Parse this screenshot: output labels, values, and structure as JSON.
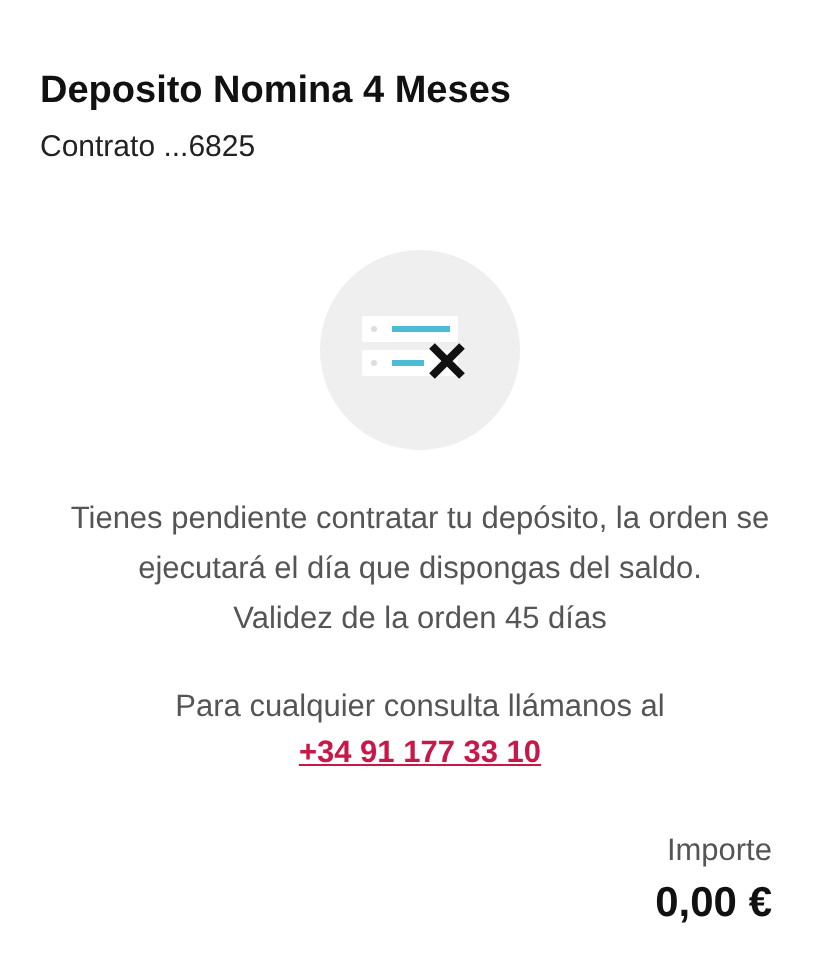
{
  "header": {
    "title": "Deposito Nomina 4 Meses",
    "contract": "Contrato ...6825"
  },
  "notice": {
    "message": "Tienes pendiente contratar tu depósito, la orden se ejecutará el día que dispongas del saldo.",
    "validity": "Validez de la orden 45 días"
  },
  "contact": {
    "text": "Para cualquier consulta llámanos al",
    "phone": "+34 91 177 33 10"
  },
  "amount": {
    "label": "Importe",
    "value": "0,00 €"
  }
}
